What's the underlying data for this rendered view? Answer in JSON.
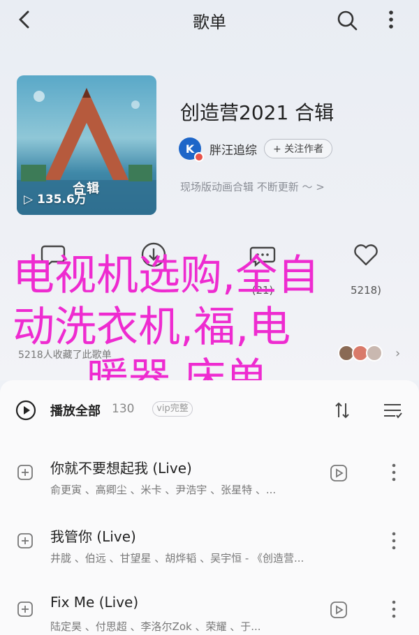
{
  "nav": {
    "title": "歌单"
  },
  "cover": {
    "play_count": "135.6万",
    "cover_text": "合辑"
  },
  "album": {
    "title": "创造营2021 合辑",
    "author": "胖汪追综",
    "avatar_letter": "K",
    "follow_label": "+ 关注作者",
    "desc": "现场版动画合辑 不断更新 ～ >"
  },
  "actions": [
    {
      "icon": "comment-icon",
      "label": ""
    },
    {
      "icon": "download-icon",
      "label": ""
    },
    {
      "icon": "share-icon",
      "label": "(21)"
    },
    {
      "icon": "favorite-icon",
      "label": "5218)"
    }
  ],
  "favorites": {
    "text": "5218人收藏了此歌单"
  },
  "watermark": {
    "line1": "电视机选购,全自",
    "line2": "动洗衣机,福,电",
    "line3": "暖器,床单"
  },
  "list": {
    "play_all_label": "播放全部",
    "count": "130",
    "vip_label": "vip完整",
    "songs": [
      {
        "name": "你就不要想起我 (Live)",
        "artists": "俞更寅 、高卿尘 、米卡 、尹浩宇 、张星特 、..."
      },
      {
        "name": "我管你 (Live)",
        "artists": "井胧 、伯远 、甘望星 、胡烨韬 、吴宇恒 - 《创造营..."
      },
      {
        "name": "Fix Me (Live)",
        "artists": "陆定昊 、付思超 、李洛尔Zok 、荣耀 、于..."
      }
    ]
  },
  "colors": {
    "accent": "#ee2bd0",
    "avatar": "#1e66c8"
  }
}
